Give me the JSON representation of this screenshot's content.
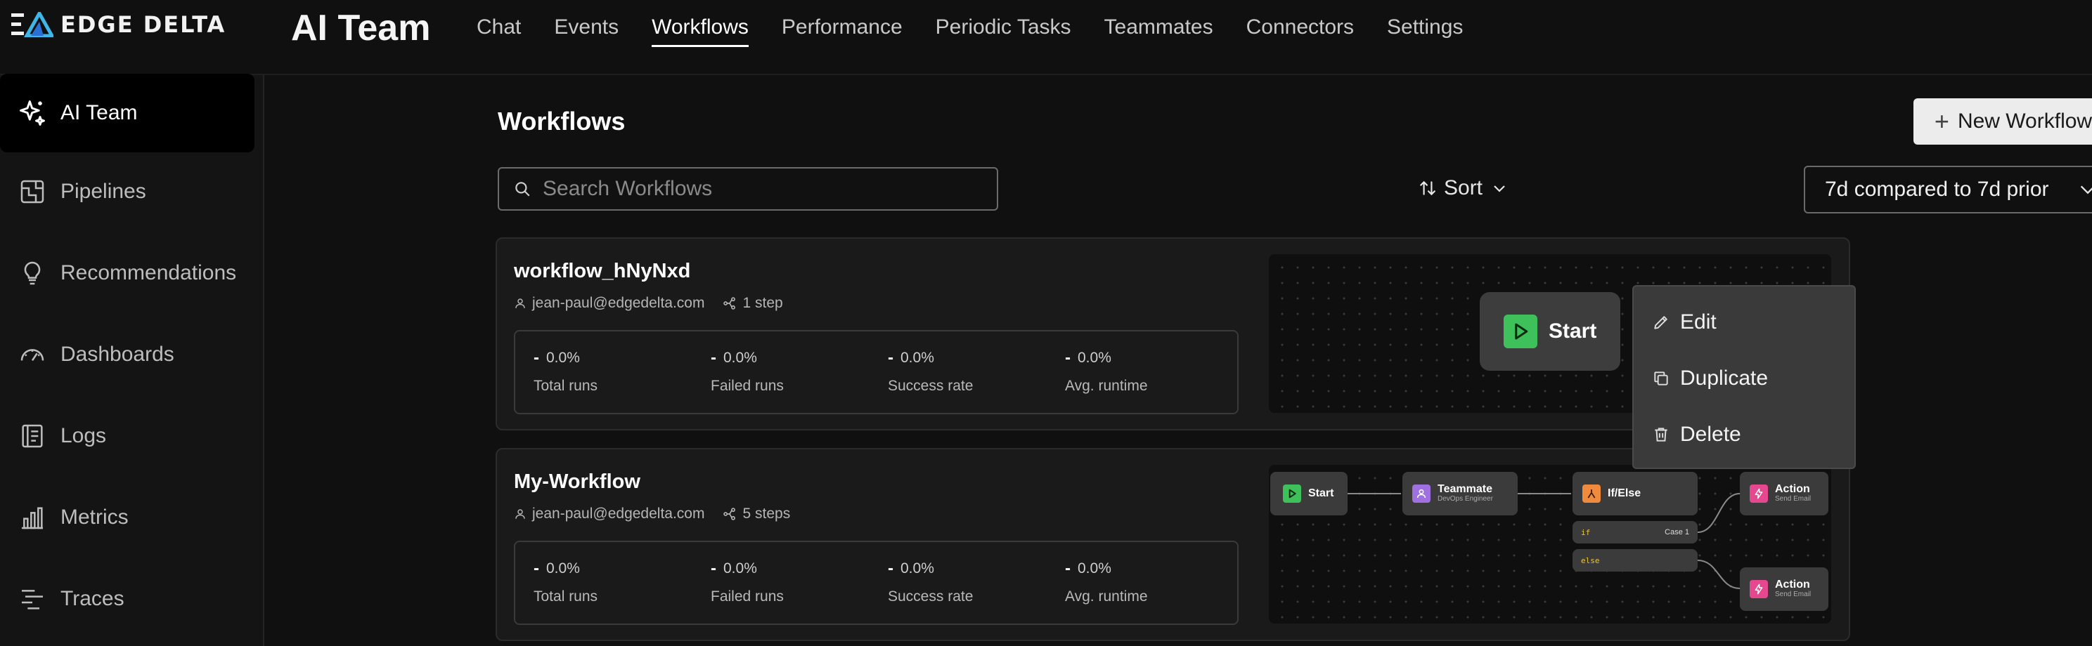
{
  "brand": {
    "name": "EDGE DELTA"
  },
  "app_title": "AI Team",
  "top_tabs": [
    {
      "label": "Chat",
      "active": false
    },
    {
      "label": "Events",
      "active": false
    },
    {
      "label": "Workflows",
      "active": true
    },
    {
      "label": "Performance",
      "active": false
    },
    {
      "label": "Periodic Tasks",
      "active": false
    },
    {
      "label": "Teammates",
      "active": false
    },
    {
      "label": "Connectors",
      "active": false
    },
    {
      "label": "Settings",
      "active": false
    }
  ],
  "sidebar": {
    "items": [
      {
        "label": "AI Team",
        "icon": "sparkles-icon",
        "active": true
      },
      {
        "label": "Pipelines",
        "icon": "pipelines-icon"
      },
      {
        "label": "Recommendations",
        "icon": "lightbulb-icon"
      },
      {
        "label": "Dashboards",
        "icon": "gauge-icon"
      },
      {
        "label": "Logs",
        "icon": "logs-icon"
      },
      {
        "label": "Metrics",
        "icon": "bar-chart-icon"
      },
      {
        "label": "Traces",
        "icon": "traces-icon"
      }
    ]
  },
  "page": {
    "title": "Workflows",
    "new_button": "New Workflow",
    "search_placeholder": "Search Workflows",
    "sort_label": "Sort",
    "range_label": "7d compared to 7d prior"
  },
  "stat_labels": [
    "Total runs",
    "Failed runs",
    "Success rate",
    "Avg. runtime"
  ],
  "workflows": [
    {
      "name": "workflow_hNyNxd",
      "owner": "jean-paul@edgedelta.com",
      "steps": "1 step",
      "stats": [
        {
          "dash": "-",
          "value": "0.0%"
        },
        {
          "dash": "-",
          "value": "0.0%"
        },
        {
          "dash": "-",
          "value": "0.0%"
        },
        {
          "dash": "-",
          "value": "0.0%"
        }
      ]
    },
    {
      "name": "My-Workflow",
      "owner": "jean-paul@edgedelta.com",
      "steps": "5 steps",
      "stats": [
        {
          "dash": "-",
          "value": "0.0%"
        },
        {
          "dash": "-",
          "value": "0.0%"
        },
        {
          "dash": "-",
          "value": "0.0%"
        },
        {
          "dash": "-",
          "value": "0.0%"
        }
      ]
    }
  ],
  "diagram_1": {
    "start": "Start"
  },
  "diagram_2": {
    "start": "Start",
    "teammate": {
      "title": "Teammate",
      "subtitle": "DevOps Engineer"
    },
    "ifelse": {
      "title": "If/Else",
      "if_label": "if",
      "case_label": "Case 1",
      "else_label": "else"
    },
    "action1": {
      "title": "Action",
      "subtitle": "Send Email"
    },
    "action2": {
      "title": "Action",
      "subtitle": "Send Email"
    }
  },
  "context_menu": {
    "items": [
      {
        "label": "Edit",
        "icon": "pencil-icon"
      },
      {
        "label": "Duplicate",
        "icon": "copy-icon"
      },
      {
        "label": "Delete",
        "icon": "trash-icon"
      }
    ]
  },
  "colors": {
    "bg": "#101010",
    "card": "#1a1a1a",
    "accent_green": "#3ec15a",
    "accent_orange": "#f08a3c",
    "accent_pink": "#e5488f",
    "accent_purple": "#a070e0"
  }
}
